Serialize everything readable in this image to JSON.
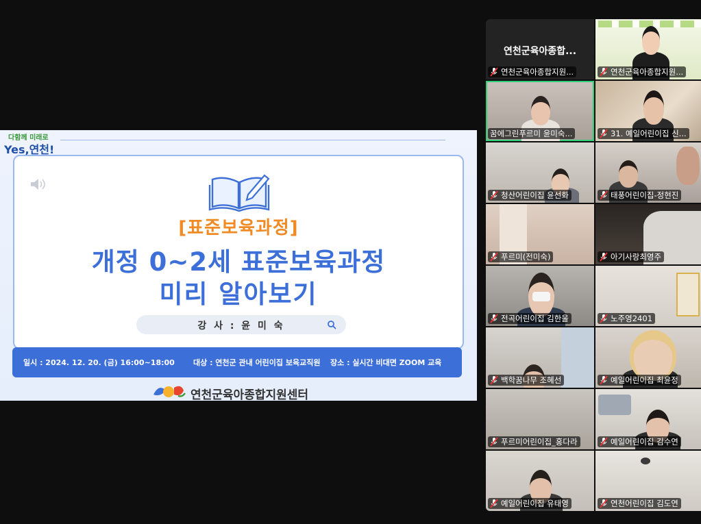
{
  "share": {
    "top_logo_line1": "다함께 미래로",
    "top_logo_line2": "Yes,연천!",
    "subtitle": "[표준보육과정]",
    "title_line1": "개정 0~2세 표준보육과정",
    "title_line2": "미리 알아보기",
    "lecturer": "강 사 : 윤 미 숙",
    "info_date": "일시 : 2024. 12. 20. (금) 16:00~18:00",
    "info_target": "대상 : 연천군 관내 어린이집 보육교직원",
    "info_place": "장소 : 실시간 비대면 ZOOM 교육",
    "org_name": "연천군육아종합지원센터",
    "accent_color": "#3d6fd9",
    "subtitle_color": "#f08a24"
  },
  "gallery": {
    "participants": [
      {
        "name": "연천군육아종합지원...",
        "big_name": "연천군육아종합...",
        "muted": true,
        "video": false
      },
      {
        "name": "연천군육아종합지원...",
        "muted": true,
        "video": true
      },
      {
        "name": "꿈에그린푸르미 윤미숙...",
        "muted": false,
        "video": true,
        "active": true
      },
      {
        "name": "31. 예일어린이집 신...",
        "muted": true,
        "video": true
      },
      {
        "name": "청산어린이집 윤선화",
        "muted": true,
        "video": true
      },
      {
        "name": "태풍어린이집-정현진",
        "muted": true,
        "video": true
      },
      {
        "name": "푸르미(전미숙)",
        "muted": true,
        "video": true
      },
      {
        "name": "아기사랑최영주",
        "muted": true,
        "video": true
      },
      {
        "name": "전곡어린이집 김한울",
        "muted": true,
        "video": true
      },
      {
        "name": "노주영2401",
        "muted": true,
        "video": true
      },
      {
        "name": "백학꿈나무 조혜선",
        "muted": true,
        "video": true
      },
      {
        "name": "예일어린이집 최윤정",
        "muted": true,
        "video": true
      },
      {
        "name": "푸르미어린이집_홍다라",
        "muted": true,
        "video": true
      },
      {
        "name": "예일어린이집 김수연",
        "muted": true,
        "video": true
      },
      {
        "name": "예일어린이집 유태영",
        "muted": true,
        "video": true
      },
      {
        "name": "연천어린이집 김도연",
        "muted": true,
        "video": true
      }
    ]
  }
}
